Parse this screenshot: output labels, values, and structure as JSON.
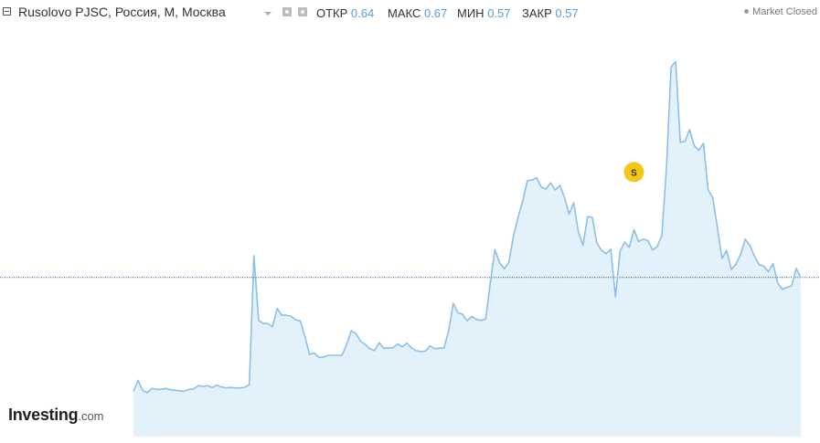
{
  "header": {
    "symbol": "Rusolovo PJSC, Россия, М, Москва",
    "ohlc": [
      {
        "label": "ОТКР",
        "value": "0.64"
      },
      {
        "label": "МАКС",
        "value": "0.67"
      },
      {
        "label": "МИН",
        "value": "0.57"
      },
      {
        "label": "ЗАКР",
        "value": "0.57"
      }
    ],
    "status": "Market Closed"
  },
  "logo": {
    "brand": "Investing",
    "tld": ".com"
  },
  "colors": {
    "line": "#8dbfe8",
    "fill": "#e3f1fb",
    "last_price_line": "#2a3f8f",
    "marker": "#f5c518"
  },
  "chart_data": {
    "type": "area",
    "title": "",
    "xlabel": "",
    "ylabel": "",
    "grid": false,
    "x": [
      0,
      1,
      2,
      3,
      4,
      5,
      6,
      7,
      8,
      9,
      10,
      11,
      12,
      13,
      14,
      15,
      16,
      17,
      18,
      19,
      20,
      21,
      22,
      23,
      24,
      25,
      26,
      27,
      28,
      29,
      30,
      31,
      32,
      33,
      34,
      35,
      36,
      37,
      38,
      39,
      40,
      41,
      42,
      43,
      44,
      45,
      46,
      47,
      48,
      49,
      50,
      51,
      52,
      53,
      54,
      55,
      56,
      57,
      58,
      59,
      60,
      61,
      62,
      63,
      64,
      65,
      66,
      67,
      68,
      69,
      70,
      71,
      72,
      73,
      74,
      75,
      76,
      77,
      78,
      79,
      80,
      81,
      82,
      83,
      84,
      85,
      86,
      87,
      88,
      89,
      90,
      91,
      92,
      93,
      94,
      95,
      96,
      97,
      98,
      99,
      100,
      101,
      102,
      103,
      104,
      105,
      106,
      107,
      108,
      109,
      110,
      111,
      112,
      113,
      114,
      115,
      116,
      117,
      118,
      119,
      120,
      121,
      122,
      123,
      124,
      125,
      126,
      127,
      128,
      129,
      130,
      131,
      132,
      133,
      134,
      135,
      136,
      137,
      138,
      139,
      140,
      141,
      142,
      143,
      144,
      145,
      146
    ],
    "values": [
      0.356,
      0.379,
      0.358,
      0.353,
      0.362,
      0.36,
      0.36,
      0.362,
      0.359,
      0.358,
      0.357,
      0.356,
      0.36,
      0.361,
      0.368,
      0.366,
      0.368,
      0.364,
      0.369,
      0.365,
      0.363,
      0.364,
      0.363,
      0.363,
      0.364,
      0.37,
      0.643,
      0.506,
      0.5,
      0.499,
      0.493,
      0.531,
      0.517,
      0.517,
      0.515,
      0.507,
      0.505,
      0.472,
      0.434,
      0.437,
      0.428,
      0.428,
      0.432,
      0.432,
      0.432,
      0.432,
      0.455,
      0.484,
      0.478,
      0.462,
      0.455,
      0.446,
      0.442,
      0.459,
      0.447,
      0.448,
      0.448,
      0.456,
      0.45,
      0.458,
      0.448,
      0.442,
      0.44,
      0.441,
      0.452,
      0.446,
      0.447,
      0.448,
      0.483,
      0.542,
      0.522,
      0.519,
      0.505,
      0.514,
      0.508,
      0.506,
      0.509,
      0.585,
      0.656,
      0.628,
      0.615,
      0.629,
      0.685,
      0.725,
      0.759,
      0.802,
      0.803,
      0.808,
      0.788,
      0.784,
      0.797,
      0.782,
      0.792,
      0.766,
      0.731,
      0.755,
      0.693,
      0.665,
      0.726,
      0.724,
      0.67,
      0.654,
      0.647,
      0.657,
      0.556,
      0.652,
      0.672,
      0.661,
      0.698,
      0.673,
      0.678,
      0.675,
      0.655,
      0.662,
      0.685,
      0.827,
      1.042,
      1.054,
      0.883,
      0.885,
      0.91,
      0.876,
      0.866,
      0.881,
      0.783,
      0.765,
      0.702,
      0.637,
      0.654,
      0.614,
      0.625,
      0.645,
      0.678,
      0.665,
      0.642,
      0.624,
      0.621,
      0.609,
      0.626,
      0.585,
      0.572,
      0.576,
      0.579,
      0.616,
      0.597
    ],
    "ylim": [
      0.26,
      1.13
    ],
    "last_value": 0.597,
    "annotations": [
      {
        "index": 108,
        "y": 0.82,
        "text": "S"
      }
    ]
  }
}
